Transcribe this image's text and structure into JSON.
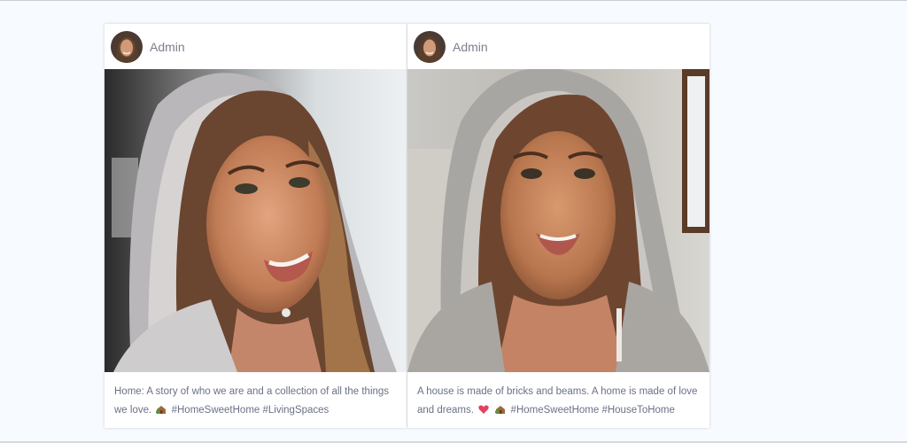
{
  "posts": [
    {
      "author": "Admin",
      "caption_text": "Home: A story of who we are and a collection of all the things we love.",
      "hashtags": "#HomeSweetHome #LivingSpaces",
      "emojis": [
        "house-with-garden-icon"
      ]
    },
    {
      "author": "Admin",
      "caption_text": "A house is made of bricks and beams. A home is made of love and dreams.",
      "hashtags": "#HomeSweetHome #HouseToHome",
      "emojis": [
        "heart-icon",
        "house-with-garden-icon"
      ]
    }
  ],
  "colors": {
    "page_background": "#f7faff",
    "card_background": "#ffffff",
    "author_text": "#7a7f8f",
    "caption_text": "#6b7186",
    "heart": "#e2435c"
  }
}
